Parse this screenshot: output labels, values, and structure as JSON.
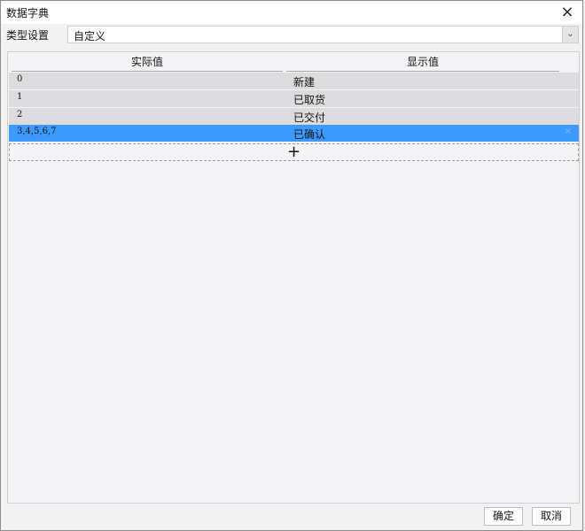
{
  "window": {
    "title": "数据字典",
    "close_icon": "×"
  },
  "type_setting": {
    "label": "类型设置",
    "value": "自定义",
    "arrow_icon": "⌄"
  },
  "table": {
    "columns": [
      "实际值",
      "显示值"
    ],
    "rows": [
      {
        "actual": "0",
        "display": "新建"
      },
      {
        "actual": "1",
        "display": "已取货"
      },
      {
        "actual": "2",
        "display": "已交付"
      },
      {
        "actual": "3,4,5,6,7",
        "display": "已确认"
      }
    ],
    "selected_row": 3,
    "delete_icon": "✕",
    "add_icon": "+"
  },
  "footer": {
    "ok_label": "确定",
    "cancel_label": "取消"
  },
  "colors": {
    "selected": "#3d9bff",
    "row_bg": "#dcdcde"
  }
}
